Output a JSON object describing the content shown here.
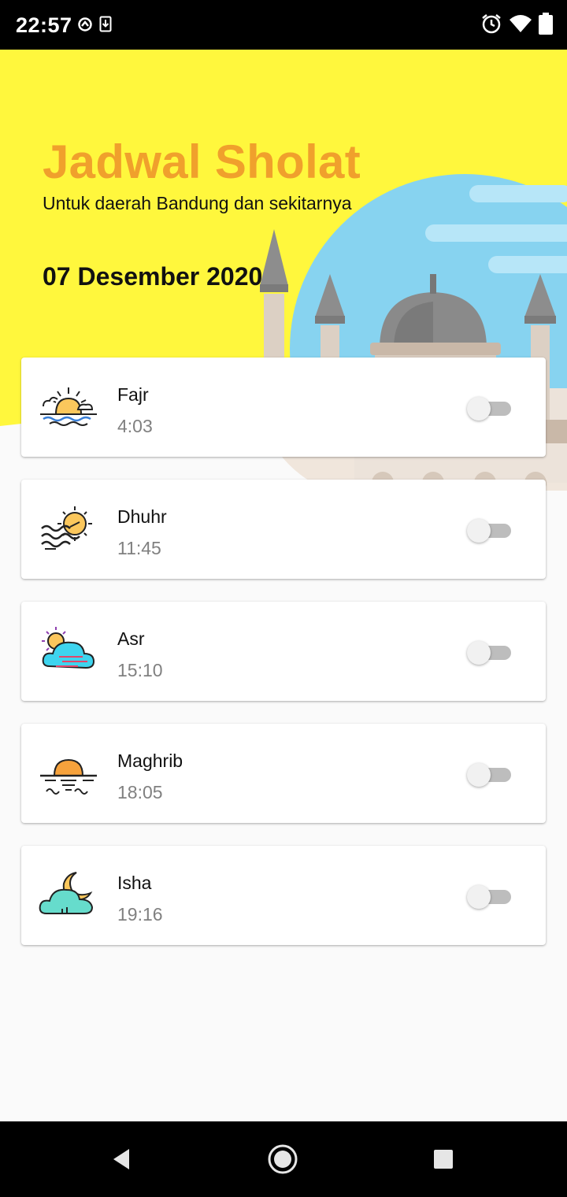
{
  "status_bar": {
    "time": "22:57",
    "icons_left": [
      "sync-icon",
      "download-icon"
    ],
    "icons_right": [
      "alarm-icon",
      "wifi-icon",
      "battery-icon"
    ]
  },
  "header": {
    "title": "Jadwal Sholat",
    "subtitle": "Untuk daerah Bandung dan sekitarnya",
    "date": "07 Desember 2020",
    "background_color": "#fff73d",
    "title_color": "#f0a02c"
  },
  "prayers": [
    {
      "name": "Fajr",
      "time": "4:03",
      "icon": "sunrise-icon",
      "enabled": false
    },
    {
      "name": "Dhuhr",
      "time": "11:45",
      "icon": "sun-wind-icon",
      "enabled": false
    },
    {
      "name": "Asr",
      "time": "15:10",
      "icon": "sun-cloud-icon",
      "enabled": false
    },
    {
      "name": "Maghrib",
      "time": "18:05",
      "icon": "sunset-icon",
      "enabled": false
    },
    {
      "name": "Isha",
      "time": "19:16",
      "icon": "moon-cloud-icon",
      "enabled": false
    }
  ],
  "nav_bar": {
    "buttons": [
      "back-icon",
      "home-icon",
      "recents-icon"
    ]
  }
}
